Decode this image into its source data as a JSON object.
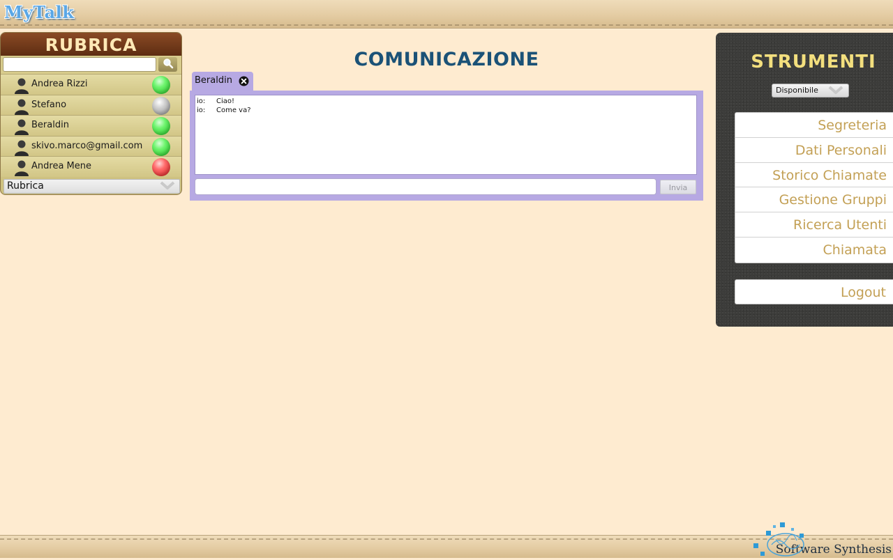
{
  "app": {
    "logo": "MyTalk",
    "footer_brand": "Software Synthesis"
  },
  "rubrica": {
    "title": "RUBRICA",
    "search_value": "",
    "search_icon": "magnifier-icon",
    "contacts": [
      {
        "name": "Andrea Rizzi",
        "status": "online"
      },
      {
        "name": "Stefano",
        "status": "offline"
      },
      {
        "name": "Beraldin",
        "status": "online"
      },
      {
        "name": "skivo.marco@gmail.com",
        "status": "online"
      },
      {
        "name": "Andrea Mene",
        "status": "busy"
      }
    ],
    "group_select": "Rubrica"
  },
  "comunicazione": {
    "title": "COMUNICAZIONE",
    "tabs": [
      {
        "label": "Beraldin"
      }
    ],
    "messages": [
      {
        "from": "io:",
        "text": "Ciao!"
      },
      {
        "from": "io:",
        "text": "Come va?"
      }
    ],
    "input_value": "",
    "send_label": "Invia"
  },
  "strumenti": {
    "title": "STRUMENTI",
    "presence_value": "Disponibile",
    "menu": [
      "Segreteria",
      "Dati Personali",
      "Storico Chiamate",
      "Gestione Gruppi",
      "Ricerca Utenti",
      "Chiamata"
    ],
    "logout_label": "Logout"
  },
  "colors": {
    "background": "#feebd0",
    "rubrica_title_bg": "#6e3718",
    "comunicazione_title": "#1b5277",
    "chat_frame": "#b7a9e3",
    "strumenti_bg": "#3c3c3a",
    "strumenti_title": "#f3df7e",
    "menu_text": "#c3a055",
    "status_online": "#2ecc2e",
    "status_offline": "#a8a8a8",
    "status_busy": "#e02a2a"
  }
}
